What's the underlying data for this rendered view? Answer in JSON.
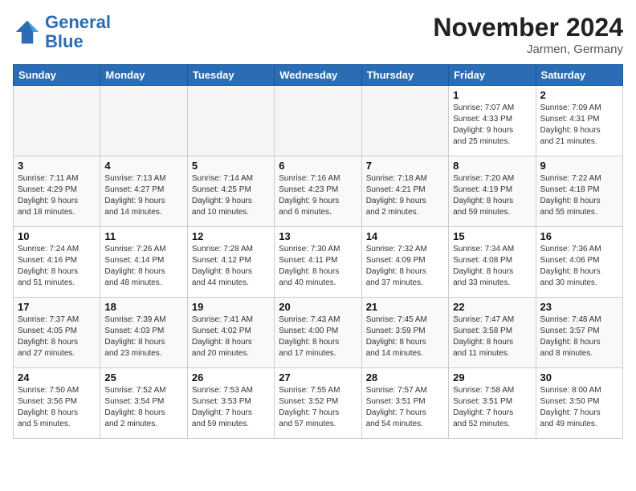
{
  "header": {
    "logo_line1": "General",
    "logo_line2": "Blue",
    "month": "November 2024",
    "location": "Jarmen, Germany"
  },
  "weekdays": [
    "Sunday",
    "Monday",
    "Tuesday",
    "Wednesday",
    "Thursday",
    "Friday",
    "Saturday"
  ],
  "weeks": [
    [
      {
        "day": "",
        "info": ""
      },
      {
        "day": "",
        "info": ""
      },
      {
        "day": "",
        "info": ""
      },
      {
        "day": "",
        "info": ""
      },
      {
        "day": "",
        "info": ""
      },
      {
        "day": "1",
        "info": "Sunrise: 7:07 AM\nSunset: 4:33 PM\nDaylight: 9 hours\nand 25 minutes."
      },
      {
        "day": "2",
        "info": "Sunrise: 7:09 AM\nSunset: 4:31 PM\nDaylight: 9 hours\nand 21 minutes."
      }
    ],
    [
      {
        "day": "3",
        "info": "Sunrise: 7:11 AM\nSunset: 4:29 PM\nDaylight: 9 hours\nand 18 minutes."
      },
      {
        "day": "4",
        "info": "Sunrise: 7:13 AM\nSunset: 4:27 PM\nDaylight: 9 hours\nand 14 minutes."
      },
      {
        "day": "5",
        "info": "Sunrise: 7:14 AM\nSunset: 4:25 PM\nDaylight: 9 hours\nand 10 minutes."
      },
      {
        "day": "6",
        "info": "Sunrise: 7:16 AM\nSunset: 4:23 PM\nDaylight: 9 hours\nand 6 minutes."
      },
      {
        "day": "7",
        "info": "Sunrise: 7:18 AM\nSunset: 4:21 PM\nDaylight: 9 hours\nand 2 minutes."
      },
      {
        "day": "8",
        "info": "Sunrise: 7:20 AM\nSunset: 4:19 PM\nDaylight: 8 hours\nand 59 minutes."
      },
      {
        "day": "9",
        "info": "Sunrise: 7:22 AM\nSunset: 4:18 PM\nDaylight: 8 hours\nand 55 minutes."
      }
    ],
    [
      {
        "day": "10",
        "info": "Sunrise: 7:24 AM\nSunset: 4:16 PM\nDaylight: 8 hours\nand 51 minutes."
      },
      {
        "day": "11",
        "info": "Sunrise: 7:26 AM\nSunset: 4:14 PM\nDaylight: 8 hours\nand 48 minutes."
      },
      {
        "day": "12",
        "info": "Sunrise: 7:28 AM\nSunset: 4:12 PM\nDaylight: 8 hours\nand 44 minutes."
      },
      {
        "day": "13",
        "info": "Sunrise: 7:30 AM\nSunset: 4:11 PM\nDaylight: 8 hours\nand 40 minutes."
      },
      {
        "day": "14",
        "info": "Sunrise: 7:32 AM\nSunset: 4:09 PM\nDaylight: 8 hours\nand 37 minutes."
      },
      {
        "day": "15",
        "info": "Sunrise: 7:34 AM\nSunset: 4:08 PM\nDaylight: 8 hours\nand 33 minutes."
      },
      {
        "day": "16",
        "info": "Sunrise: 7:36 AM\nSunset: 4:06 PM\nDaylight: 8 hours\nand 30 minutes."
      }
    ],
    [
      {
        "day": "17",
        "info": "Sunrise: 7:37 AM\nSunset: 4:05 PM\nDaylight: 8 hours\nand 27 minutes."
      },
      {
        "day": "18",
        "info": "Sunrise: 7:39 AM\nSunset: 4:03 PM\nDaylight: 8 hours\nand 23 minutes."
      },
      {
        "day": "19",
        "info": "Sunrise: 7:41 AM\nSunset: 4:02 PM\nDaylight: 8 hours\nand 20 minutes."
      },
      {
        "day": "20",
        "info": "Sunrise: 7:43 AM\nSunset: 4:00 PM\nDaylight: 8 hours\nand 17 minutes."
      },
      {
        "day": "21",
        "info": "Sunrise: 7:45 AM\nSunset: 3:59 PM\nDaylight: 8 hours\nand 14 minutes."
      },
      {
        "day": "22",
        "info": "Sunrise: 7:47 AM\nSunset: 3:58 PM\nDaylight: 8 hours\nand 11 minutes."
      },
      {
        "day": "23",
        "info": "Sunrise: 7:48 AM\nSunset: 3:57 PM\nDaylight: 8 hours\nand 8 minutes."
      }
    ],
    [
      {
        "day": "24",
        "info": "Sunrise: 7:50 AM\nSunset: 3:56 PM\nDaylight: 8 hours\nand 5 minutes."
      },
      {
        "day": "25",
        "info": "Sunrise: 7:52 AM\nSunset: 3:54 PM\nDaylight: 8 hours\nand 2 minutes."
      },
      {
        "day": "26",
        "info": "Sunrise: 7:53 AM\nSunset: 3:53 PM\nDaylight: 7 hours\nand 59 minutes."
      },
      {
        "day": "27",
        "info": "Sunrise: 7:55 AM\nSunset: 3:52 PM\nDaylight: 7 hours\nand 57 minutes."
      },
      {
        "day": "28",
        "info": "Sunrise: 7:57 AM\nSunset: 3:51 PM\nDaylight: 7 hours\nand 54 minutes."
      },
      {
        "day": "29",
        "info": "Sunrise: 7:58 AM\nSunset: 3:51 PM\nDaylight: 7 hours\nand 52 minutes."
      },
      {
        "day": "30",
        "info": "Sunrise: 8:00 AM\nSunset: 3:50 PM\nDaylight: 7 hours\nand 49 minutes."
      }
    ]
  ]
}
